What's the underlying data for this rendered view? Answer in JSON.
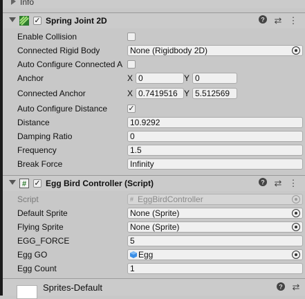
{
  "info_header": {
    "label": "Info"
  },
  "spring_joint": {
    "title": "Spring Joint 2D",
    "enabled_mark": "✓",
    "enable_collision": {
      "label": "Enable Collision",
      "checked": false
    },
    "connected_rigidbody": {
      "label": "Connected Rigid Body",
      "value": "None (Rigidbody 2D)"
    },
    "auto_configure_connected_anchor": {
      "label": "Auto Configure Connected A",
      "checked": false
    },
    "anchor": {
      "label": "Anchor",
      "x_label": "X",
      "x": "0",
      "y_label": "Y",
      "y": "0"
    },
    "connected_anchor": {
      "label": "Connected Anchor",
      "x_label": "X",
      "x": "0.7419516",
      "y_label": "Y",
      "y": "5.512569"
    },
    "auto_configure_distance": {
      "label": "Auto Configure Distance",
      "checked": true,
      "mark": "✓"
    },
    "distance": {
      "label": "Distance",
      "value": "10.9292"
    },
    "damping_ratio": {
      "label": "Damping Ratio",
      "value": "0"
    },
    "frequency": {
      "label": "Frequency",
      "value": "1.5"
    },
    "break_force": {
      "label": "Break Force",
      "value": "Infinity"
    }
  },
  "egg_bird_controller": {
    "title": "Egg Bird Controller (Script)",
    "enabled_mark": "✓",
    "script": {
      "label": "Script",
      "value": "EggBirdController"
    },
    "default_sprite": {
      "label": "Default Sprite",
      "value": "None (Sprite)"
    },
    "flying_sprite": {
      "label": "Flying Sprite",
      "value": "None (Sprite)"
    },
    "egg_force": {
      "label": "EGG_FORCE",
      "value": "5"
    },
    "egg_go": {
      "label": "Egg GO",
      "value": "Egg"
    },
    "egg_count": {
      "label": "Egg Count",
      "value": "1"
    }
  },
  "material_footer": {
    "label": "Sprites-Default"
  },
  "icons": {
    "help": "?",
    "settings": "⇄",
    "more": "⋮"
  }
}
